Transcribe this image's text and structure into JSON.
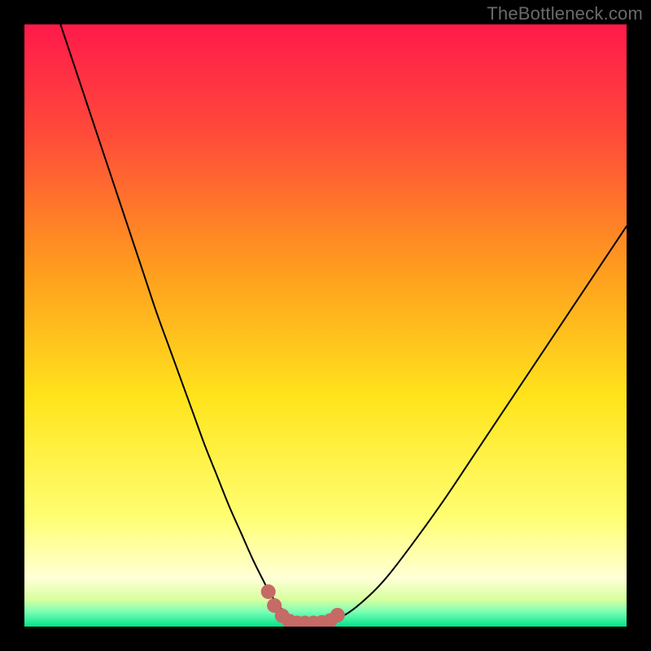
{
  "watermark": "TheBottleneck.com",
  "chart_data": {
    "type": "line",
    "title": "",
    "xlabel": "",
    "ylabel": "",
    "xlim": [
      0,
      100
    ],
    "ylim": [
      0,
      100
    ],
    "grid": false,
    "legend": false,
    "background_gradient_stops": [
      {
        "offset": 0.0,
        "color": "#ff1a4b"
      },
      {
        "offset": 0.18,
        "color": "#ff4a3a"
      },
      {
        "offset": 0.4,
        "color": "#ff9a1f"
      },
      {
        "offset": 0.62,
        "color": "#ffe41c"
      },
      {
        "offset": 0.82,
        "color": "#ffff73"
      },
      {
        "offset": 0.92,
        "color": "#ffffd6"
      },
      {
        "offset": 0.955,
        "color": "#d7ff9e"
      },
      {
        "offset": 0.975,
        "color": "#7dffb5"
      },
      {
        "offset": 1.0,
        "color": "#00e58a"
      }
    ],
    "series": [
      {
        "name": "bottleneck-curve",
        "stroke": "#000000",
        "stroke_width": 2,
        "x": [
          6,
          8,
          10,
          12,
          14,
          16,
          18,
          20,
          22,
          24,
          26,
          28,
          30,
          32,
          34,
          36,
          38,
          40,
          41,
          42,
          43,
          44,
          45,
          46,
          47,
          48,
          50,
          53,
          56,
          60,
          65,
          70,
          75,
          80,
          85,
          90,
          95,
          100
        ],
        "y": [
          100,
          94,
          88,
          82,
          76,
          70,
          64,
          58,
          52,
          46.5,
          41,
          35.5,
          30,
          25,
          20,
          15.5,
          11,
          7,
          5.2,
          3.8,
          2.6,
          1.7,
          1.1,
          0.7,
          0.5,
          0.5,
          0.6,
          1.8,
          4.0,
          8.0,
          14.5,
          21.5,
          29,
          36.5,
          44,
          51.5,
          59,
          66.5
        ]
      }
    ],
    "markers": {
      "name": "bottom-markers",
      "fill": "#c66a66",
      "r": 9,
      "points": [
        {
          "x": 40.5,
          "y": 5.8
        },
        {
          "x": 41.5,
          "y": 3.5
        },
        {
          "x": 42.8,
          "y": 1.8
        },
        {
          "x": 44.0,
          "y": 0.9
        },
        {
          "x": 45.3,
          "y": 0.6
        },
        {
          "x": 46.6,
          "y": 0.6
        },
        {
          "x": 48.0,
          "y": 0.6
        },
        {
          "x": 49.4,
          "y": 0.7
        },
        {
          "x": 50.8,
          "y": 1.0
        },
        {
          "x": 52.0,
          "y": 1.9
        }
      ]
    }
  }
}
